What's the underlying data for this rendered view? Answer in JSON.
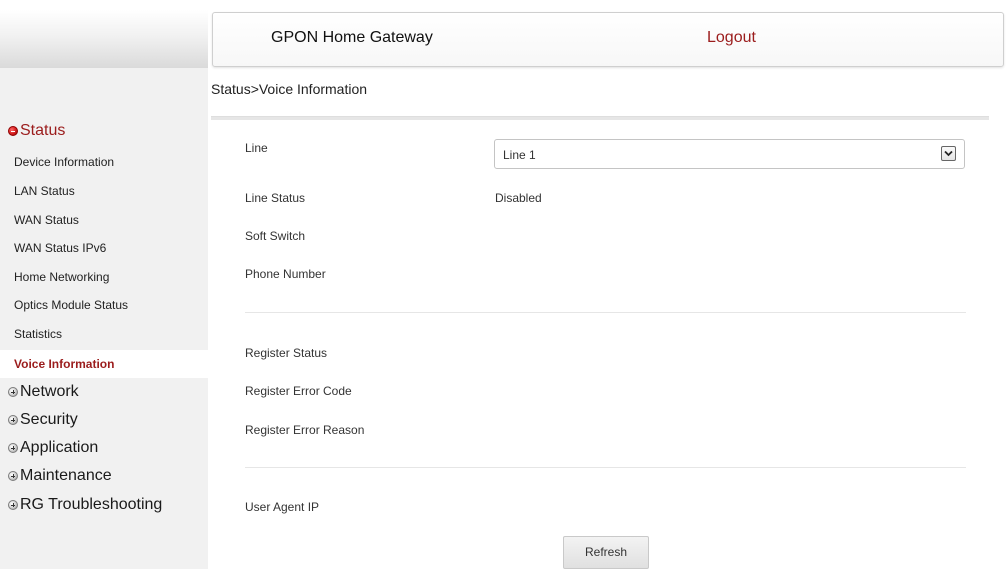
{
  "header": {
    "title": "GPON Home Gateway",
    "logout_label": "Logout"
  },
  "breadcrumb": "Status>Voice Information",
  "sidebar": {
    "status_section": "Status",
    "status_items": [
      "Device Information",
      "LAN Status",
      "WAN Status",
      "WAN Status IPv6",
      "Home Networking",
      "Optics Module Status",
      "Statistics",
      "Voice Information"
    ],
    "active_item": "Voice Information",
    "collapsed_sections": [
      "Network",
      "Security",
      "Application",
      "Maintenance",
      "RG Troubleshooting"
    ]
  },
  "form": {
    "line_label": "Line",
    "line_selected": "Line 1",
    "line_status_label": "Line Status",
    "line_status_value": "Disabled",
    "soft_switch_label": "Soft Switch",
    "soft_switch_value": "",
    "phone_number_label": "Phone Number",
    "phone_number_value": "",
    "register_status_label": "Register Status",
    "register_status_value": "",
    "register_error_code_label": "Register Error Code",
    "register_error_code_value": "",
    "register_error_reason_label": "Register Error Reason",
    "register_error_reason_value": "",
    "user_agent_ip_label": "User Agent IP",
    "user_agent_ip_value": ""
  },
  "buttons": {
    "refresh_label": "Refresh"
  },
  "colors": {
    "accent": "#9b1c1c",
    "sidebar_bg": "#f1f1f1",
    "status_icon": "#d41e1e"
  },
  "icons": {
    "expanded_section": "minus-circle-icon",
    "collapsed_section": "plus-circle-icon",
    "select_arrow": "chevron-down-icon"
  }
}
